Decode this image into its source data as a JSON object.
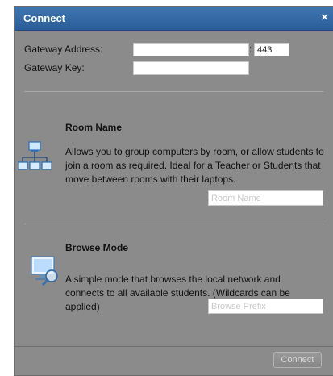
{
  "dialog": {
    "title": "Connect",
    "close_glyph": "×"
  },
  "gateway": {
    "address_label": "Gateway Address:",
    "address_value": "",
    "port_separator": ":",
    "port_value": "443",
    "key_label": "Gateway Key:",
    "key_value": ""
  },
  "room": {
    "heading": "Room Name",
    "icon": "network-computers-icon",
    "description": "Allows you to group computers by room, or allow students to join a room as required. Ideal for a Teacher or Students that move between rooms with their laptops.",
    "placeholder": "Room Name"
  },
  "browse": {
    "heading": "Browse Mode",
    "icon": "monitor-magnifier-icon",
    "description": "A simple mode that browses the local network and connects to all available students. (Wildcards can be applied)",
    "placeholder": "Browse Prefix"
  },
  "footer": {
    "connect_label": "Connect"
  },
  "colors": {
    "title_bar": "#2f66a5",
    "panel": "#8b8b8b"
  }
}
